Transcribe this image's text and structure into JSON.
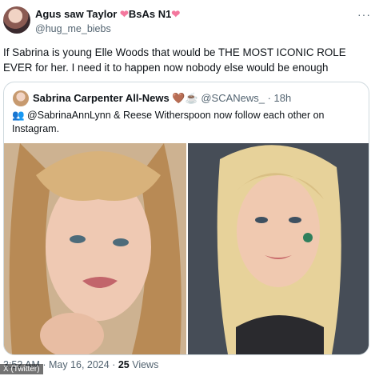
{
  "tweet": {
    "author_name": "Agus saw Taylor",
    "author_suffix": "BsAs N1",
    "heart": "❤",
    "handle": "@hug_me_biebs",
    "more": "···",
    "text": "If Sabrina is young Elle Woods that would be THE MOST ICONIC ROLE EVER for her. I need it to happen now nobody else would be enough",
    "timestamp": "3:52 AM · May 16, 2024 · ",
    "views_count": "25",
    "views_label": " Views",
    "credit": "X (Twitter)"
  },
  "quote": {
    "name": "Sabrina Carpenter All-News",
    "emoji": "🤎☕",
    "meta": " @SCANews_ · 18h",
    "text": "👥 @SabrinaAnnLynn & Reese Witherspoon now follow each other on Instagram."
  },
  "colors": {
    "secondary_text": "#536471",
    "border": "#cfd9de",
    "heart": "#f4789e"
  }
}
